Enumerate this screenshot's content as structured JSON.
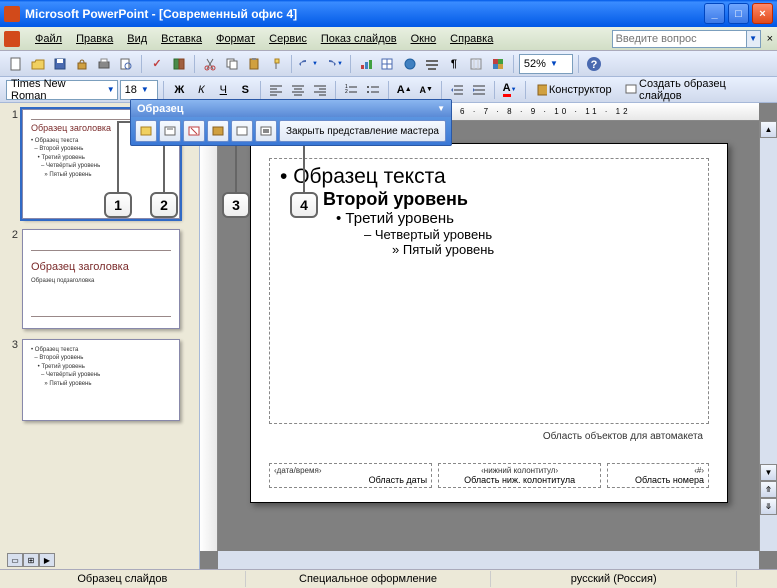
{
  "window": {
    "title": "Microsoft PowerPoint - [Современный офис 4]"
  },
  "menu": {
    "file": "Файл",
    "edit": "Правка",
    "view": "Вид",
    "insert": "Вставка",
    "format": "Формат",
    "tools": "Сервис",
    "slideshow": "Показ слайдов",
    "window": "Окно",
    "help": "Справка"
  },
  "help_placeholder": "Введите вопрос",
  "zoom": "52%",
  "font": {
    "name": "Times New Roman",
    "size": "18"
  },
  "fmt": {
    "bold": "Ж",
    "italic": "К",
    "underline": "Ч",
    "shadow": "S",
    "designer": "Конструктор",
    "create_master": "Создать образец слайдов"
  },
  "master_toolbar": {
    "title": "Образец",
    "close": "Закрыть представление мастера"
  },
  "callouts": {
    "c1": "1",
    "c2": "2",
    "c3": "3",
    "c4": "4"
  },
  "thumbs": {
    "t1": {
      "num": "1",
      "title": "Образец заголовка",
      "b1": "Образец текста",
      "b2": "Второй уровень",
      "b3": "Третий уровень",
      "b4": "Четвёртый уровень",
      "b5": "Пятый уровень"
    },
    "t2": {
      "num": "2",
      "title": "Образец заголовка",
      "sub": "Образец подзаголовка"
    },
    "t3": {
      "num": "3",
      "b1": "Образец текста",
      "b2": "Второй уровень",
      "b3": "Третий уровень",
      "b4": "Четвёртый уровень",
      "b5": "Пятый уровень"
    }
  },
  "slide": {
    "lvl1": "Образец текста",
    "lvl2": "Второй уровень",
    "lvl3": "Третий уровень",
    "lvl4": "Четвертый уровень",
    "lvl5": "Пятый уровень",
    "obj_area": "Область объектов для автомакета",
    "date_ph": "‹дата/время›",
    "date_lbl": "Область даты",
    "footer_ph": "‹нижний колонтитул›",
    "footer_lbl": "Область ниж. колонтитула",
    "num_ph": "‹#›",
    "num_lbl": "Область номера"
  },
  "ruler": "1 · 2 · 1 · 0 · 1 · 2 · 3 · 4 · 5 · 6 · 7 · 8 · 9 · 10 · 11 · 12",
  "status": {
    "seg1": "Образец слайдов",
    "seg2": "Специальное оформление",
    "seg3": "русский (Россия)"
  }
}
